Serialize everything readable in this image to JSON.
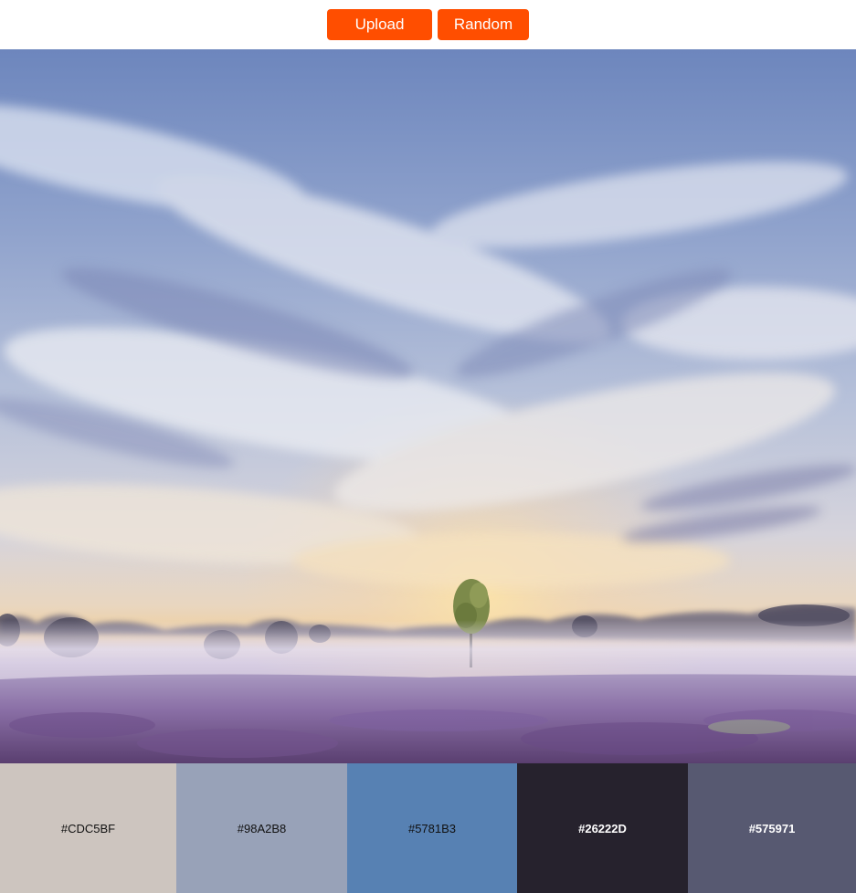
{
  "toolbar": {
    "upload_label": "Upload",
    "random_label": "Random",
    "button_color": "#FF4E00"
  },
  "image": {
    "subject": "misty heathland at sunrise with a lone tree under a cloudy blue sky"
  },
  "palette": {
    "swatches": [
      {
        "hex": "#CDC5BF",
        "label": "#CDC5BF"
      },
      {
        "hex": "#98A2B8",
        "label": "#98A2B8"
      },
      {
        "hex": "#5781B3",
        "label": "#5781B3"
      },
      {
        "hex": "#26222D",
        "label": "#26222D"
      },
      {
        "hex": "#575971",
        "label": "#575971"
      }
    ]
  }
}
